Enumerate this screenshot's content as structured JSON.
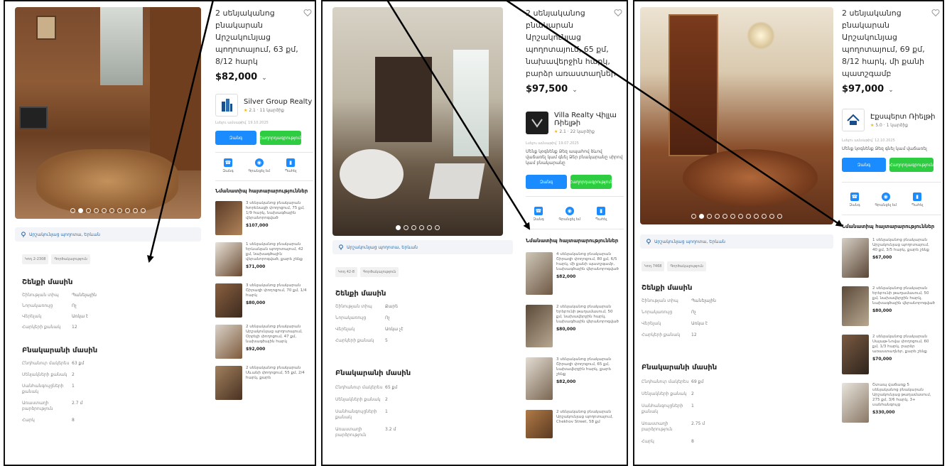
{
  "panels": [
    {
      "title": "2 սենյականոց բնակարան Արշակունյաց պողոտայում, 63 քմ, 8/12 հարկ",
      "price": "$82,000",
      "agent": {
        "name": "Silver Group Realty",
        "rating": "2.1 · 11 կարծիք",
        "logo": "building-logo"
      },
      "meta": "Լսելու ամսաթիվ՝ 19.10.2025",
      "desc": "",
      "call_label": "Զանգ",
      "message_label": "Հաղորդագրություն",
      "actions": [
        "Զանգ",
        "Գրանցել եմ",
        "Պահել"
      ],
      "similar_heading": "Նմանատիպ հայտարարություններ",
      "similar": [
        {
          "text": "3 սենյականոց բնակարան Խորենացի փողոցում, 75 քմ, 1/9 հարկ, նախագծային վերանորոգված",
          "price": "$107,000"
        },
        {
          "text": "1 սենյականոց բնակարան Երևանյան պողոտայում, 42 քմ, նախագծային վերանորոգված, քարե շենք",
          "price": "$71,000"
        },
        {
          "text": "3 սենյականոց բնակարան Շիրազի փողոցում, 70 քմ, 1/4 հարկ",
          "price": "$80,000"
        },
        {
          "text": "2 սենյականոց բնակարան Արշակունյաց պողոտայում, Օրբելի փողոցում, 47 քմ, նախագծային հարկ",
          "price": "$92,000"
        },
        {
          "text": "2 սենյականոց բնակարան Սևանի փողոցում, 55 քմ, 2/4 հարկ, քարե",
          "price": ""
        }
      ],
      "location": "Արշակունյաց պողոտա, Երևան",
      "tags": [
        "Կոդ 2-2308",
        "Գործակալություն"
      ],
      "building_heading": "Շենքի մասին",
      "building": [
        [
          "Շինության տիպ",
          "Պանելային"
        ],
        [
          "Նորակառույց",
          "Ոչ"
        ],
        [
          "Վերելակ",
          "Առկա է"
        ],
        [
          "Հարկերի քանակ",
          "12"
        ]
      ],
      "apt_heading": "Բնակարանի մասին",
      "apt": [
        [
          "Ընդհանուր մակերես",
          "63 քմ"
        ],
        [
          "Սենյակների քանակ",
          "2"
        ],
        [
          "Սանհանգույցների քանակ",
          "1"
        ],
        [
          "Առաստաղի բարձրություն",
          "2.7 մ"
        ],
        [
          "Հարկ",
          "8"
        ]
      ]
    },
    {
      "title": "2 սենյականոց բնակարան Արշակունյաց պողոտայում, 65 քմ, նախավերջին հարկ, բարձր առաստաղներ",
      "price": "$97,500",
      "agent": {
        "name": "Villa Realty Վիլլա Ռիելթի",
        "rating": "2.1 · 22 կարծիք",
        "logo": "villa-logo"
      },
      "meta": "Լսելու ամսաթիվ՝ 19.07.2025",
      "desc": "Մենք կօգնենք Ձեզ ապահով ձևով վաճառել կամ գնել Ձեր բնակարանը սիրով կամ բնակարանը",
      "call_label": "Զանգ",
      "message_label": "Հաղորդագրություն",
      "actions": [
        "Զանգ",
        "Գրանցել եմ",
        "Պահել"
      ],
      "similar_heading": "Նմանատիպ հայտարարություններ",
      "similar": [
        {
          "text": "4 սենյականոց բնակարան Շիրազի փողոցում, 80 քմ, 6/5 հարկ, մի քանի պատշգամբ, նախագծային վերանորոգված",
          "price": "$82,000"
        },
        {
          "text": "2 սենյականոց բնակարան Երեբունի թաղամասում, 50 քմ, նախավերջին հարկ, նախագծային վերանորոգված",
          "price": "$80,000"
        },
        {
          "text": "3 սենյականոց բնակարան Շիրազի փողոցում, 65 քմ, նախավերջին հարկ, քարե շենք",
          "price": "$82,000"
        },
        {
          "text": "2 սենյականոց բնակարան Արշակունյաց պողոտայում, Chekhov Street, 58 քմ",
          "price": ""
        }
      ],
      "location": "Արշակունյաց պողոտա, Երևան",
      "tags": [
        "Կոդ 42-8",
        "Գործակալություն"
      ],
      "building_heading": "Շենքի մասին",
      "building": [
        [
          "Շինության տիպ",
          "Քարե"
        ],
        [
          "Նորակառույց",
          "Ոչ"
        ],
        [
          "Վերելակ",
          "Առկա չէ"
        ],
        [
          "Հարկերի քանակ",
          "5"
        ]
      ],
      "apt_heading": "Բնակարանի մասին",
      "apt": [
        [
          "Ընդհանուր մակերես",
          "65 քմ"
        ],
        [
          "Սենյակների քանակ",
          "2"
        ],
        [
          "Սանհանգույցների քանակ",
          "1"
        ],
        [
          "Առաստաղի բարձրություն",
          "3.2 մ"
        ]
      ]
    },
    {
      "title": "2 սենյականոց բնակարան Արշակունյաց պողոտայում, 69 քմ, 8/12 հարկ, մի քանի պատշգամբ",
      "price": "$97,000",
      "agent": {
        "name": "Էքսպերտ Ռիելթի",
        "rating": "5.0 · 1 կարծիք",
        "logo": "expert-logo"
      },
      "meta": "Լսելու ամսաթիվ՝ 12.10.2025",
      "desc": "Մենք կօգնենք Ձեզ գնել կամ վաճառել",
      "call_label": "Զանգ",
      "message_label": "Հաղորդագրություն",
      "actions": [
        "Զանգ",
        "Գրանցել եմ",
        "Պահել"
      ],
      "similar_heading": "Նմանատիպ հայտարարություններ",
      "similar": [
        {
          "text": "1 սենյականոց բնակարան Արշակունյաց պողոտայում, 40 քմ, 3/5 հարկ, քարե շենք",
          "price": "$67,000"
        },
        {
          "text": "2 սենյականոց բնակարան Երեբունի թաղամասում, 50 քմ, նախավերջին հարկ, նախագծային վերանորոգված",
          "price": "$80,000"
        },
        {
          "text": "2 սենյականոց բնակարան Սայաթ-Նովա փողոցում, 60 քմ, 1/3 հարկ, բարձր առաստաղներ, քարե շենք",
          "price": "$70,000"
        },
        {
          "text": "Շտապ վաճառք 5 սենյականոց բնակարան Արշակունյաց թաղամասում, 275 քմ, 3/6 հարկ, 3+ սանհանգույց",
          "price": "$330,000"
        }
      ],
      "location": "Արշակունյաց պողոտա, Երևան",
      "tags": [
        "Կոդ 7468",
        "Գործակալություն"
      ],
      "building_heading": "Շենքի մասին",
      "building": [
        [
          "Շինության տիպ",
          "Պանելային"
        ],
        [
          "Նորակառույց",
          "Ոչ"
        ],
        [
          "Վերելակ",
          "Առկա է"
        ],
        [
          "Հարկերի քանակ",
          "12"
        ]
      ],
      "apt_heading": "Բնակարանի մասին",
      "apt": [
        [
          "Ընդհանուր մակերես",
          "69 քմ"
        ],
        [
          "Սենյակների քանակ",
          "2"
        ],
        [
          "Սանհանգույցների քանակ",
          "1"
        ],
        [
          "Առաստաղի բարձրություն",
          "2.75 մ"
        ],
        [
          "Հարկ",
          "8"
        ]
      ]
    }
  ],
  "colors": {
    "call": "#1a8cff",
    "message": "#2ecc40",
    "link": "#2a6db0",
    "arrow": "#000000"
  },
  "icons": [
    "heart-icon",
    "chevron-down-icon",
    "star-icon",
    "location-pin-icon",
    "phone-icon",
    "eye-icon",
    "bookmark-icon"
  ]
}
